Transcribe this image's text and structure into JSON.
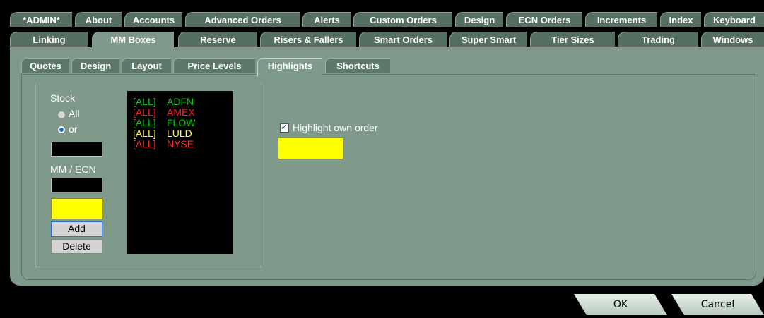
{
  "tabs_row1": [
    "*ADMIN*",
    "About",
    "Accounts",
    "Advanced Orders",
    "Alerts",
    "Custom Orders",
    "Design",
    "ECN Orders",
    "Increments",
    "Index",
    "Keyboard"
  ],
  "tabs_row2": [
    "Linking",
    "MM Boxes",
    "Reserve",
    "Risers & Fallers",
    "Smart Orders",
    "Super Smart",
    "Tier Sizes",
    "Trading",
    "Windows"
  ],
  "active_tab": "MM Boxes",
  "subtabs": [
    "Quotes",
    "Design",
    "Layout",
    "Price Levels",
    "Highlights",
    "Shortcuts"
  ],
  "active_subtab": "Highlights",
  "left": {
    "stock_label": "Stock",
    "radio_all": "All",
    "radio_or": "or",
    "mm_ecn_label": "MM / ECN",
    "add_button": "Add",
    "delete_button": "Delete"
  },
  "highlight_list": [
    {
      "scope": "[ALL]",
      "name": "ADFN",
      "color": "#00cc00"
    },
    {
      "scope": "[ALL]",
      "name": "AMEX",
      "color": "#ff2020"
    },
    {
      "scope": "[ALL]",
      "name": "FLOW",
      "color": "#00cc00"
    },
    {
      "scope": "[ALL]",
      "name": "LULD",
      "color": "#ffff40"
    },
    {
      "scope": "[ALL]",
      "name": "NYSE",
      "color": "#ff3030"
    }
  ],
  "right": {
    "highlight_own_order_label": "Highlight own order",
    "highlight_own_order_checked": true,
    "highlight_color": "#ffff00"
  },
  "footer": {
    "ok_label": "OK",
    "cancel_label": "Cancel"
  }
}
